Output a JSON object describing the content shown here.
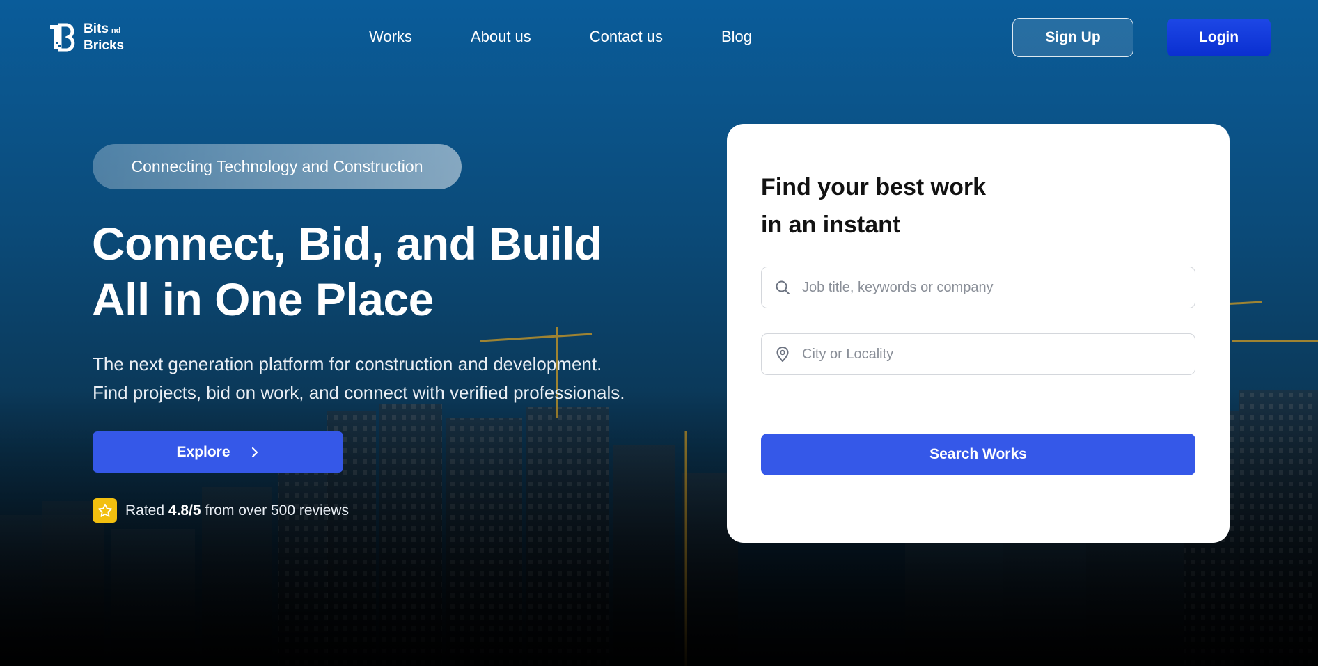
{
  "brand": {
    "name_line1": "Bits",
    "name_sup": "nd",
    "name_line2": "Bricks"
  },
  "nav": {
    "links": [
      "Works",
      "About us",
      "Contact us",
      "Blog"
    ],
    "signup_label": "Sign Up",
    "login_label": "Login"
  },
  "hero": {
    "pill": "Connecting Technology and Construction",
    "headline_line1": "Connect, Bid, and Build",
    "headline_line2": "All in One Place",
    "sub_line1": "The next generation platform for construction and development.",
    "sub_line2": "Find projects, bid on work, and connect with verified professionals.",
    "explore_label": "Explore",
    "rating_prefix": "Rated",
    "rating_value": "4.8/5",
    "rating_suffix": "from over 500 reviews"
  },
  "search_card": {
    "title_line1": "Find your best work",
    "title_line2": "in an instant",
    "keyword_placeholder": "Job title, keywords or company",
    "location_placeholder": "City or Locality",
    "search_label": "Search Works"
  },
  "colors": {
    "primary_button": "#3558e8",
    "login_button": "#1d47e6",
    "star_badge": "#f2bf0f",
    "sky_top": "#0a5c9a"
  },
  "icons": {
    "logo": "bits-and-bricks-logo",
    "chevron": "chevron-right-icon",
    "star": "star-icon",
    "search": "search-icon",
    "location": "location-pin-icon"
  }
}
